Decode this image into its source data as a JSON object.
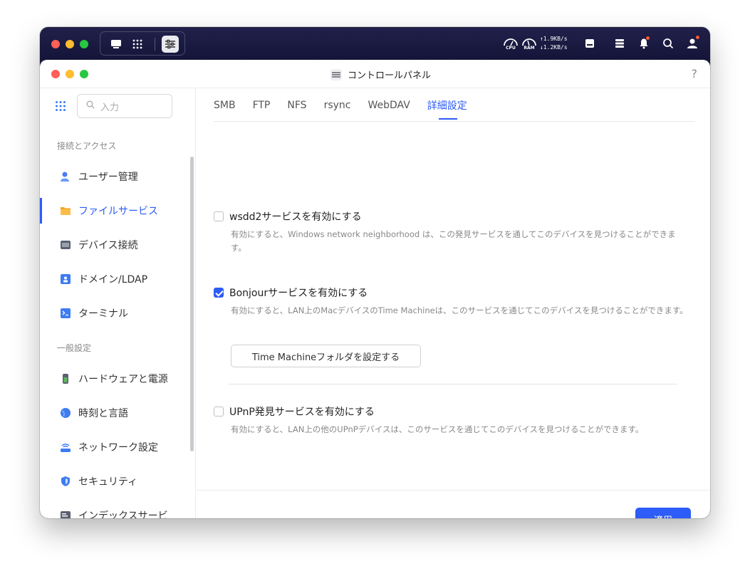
{
  "outer": {
    "speed_up": "1.9KB/s",
    "speed_down": "1.2KB/s",
    "cpu_label": "CPU",
    "ram_label": "RAM"
  },
  "window": {
    "title": "コントロールパネル",
    "help": "?"
  },
  "sidebar": {
    "search_placeholder": "入力",
    "section1": "接続とアクセス",
    "section2": "一般設定",
    "items": [
      {
        "label": "ユーザー管理",
        "icon": "user-icon",
        "color": "#4a7cf0"
      },
      {
        "label": "ファイルサービス",
        "icon": "folder-icon",
        "color": "#f5a623"
      },
      {
        "label": "デバイス接続",
        "icon": "device-icon",
        "color": "#5a6070"
      },
      {
        "label": "ドメイン/LDAP",
        "icon": "domain-icon",
        "color": "#3d7cf2"
      },
      {
        "label": "ターミナル",
        "icon": "terminal-icon",
        "color": "#3d7cf2"
      },
      {
        "label": "ハードウェアと電源",
        "icon": "hardware-icon",
        "color": "#5bb85d"
      },
      {
        "label": "時刻と言語",
        "icon": "globe-icon",
        "color": "#3d7cf2"
      },
      {
        "label": "ネットワーク設定",
        "icon": "network-icon",
        "color": "#3d7cf2"
      },
      {
        "label": "セキュリティ",
        "icon": "shield-icon",
        "color": "#3d7cf2"
      },
      {
        "label": "インデックスサービ",
        "icon": "index-icon",
        "color": "#5a6070"
      }
    ]
  },
  "tabs": [
    "SMB",
    "FTP",
    "NFS",
    "rsync",
    "WebDAV",
    "詳細設定"
  ],
  "options": [
    {
      "label": "wsdd2サービスを有効にする",
      "checked": false,
      "desc": "有効にすると、Windows network neighborhood は、この発見サービスを通してこのデバイスを見つけることができます。"
    },
    {
      "label": "Bonjourサービスを有効にする",
      "checked": true,
      "desc": "有効にすると、LAN上のMacデバイスのTime Machineは、このサービスを通じてこのデバイスを見つけることができます。"
    },
    {
      "label": "UPnP発見サービスを有効にする",
      "checked": false,
      "desc": "有効にすると、LAN上の他のUPnPデバイスは、このサービスを通じてこのデバイスを見つけることができます。"
    }
  ],
  "tm_button": "Time Machineフォルダを設定する",
  "apply_button": "適用",
  "colors": {
    "accent": "#2d5cf6",
    "topbar": "#1a1a3a"
  }
}
